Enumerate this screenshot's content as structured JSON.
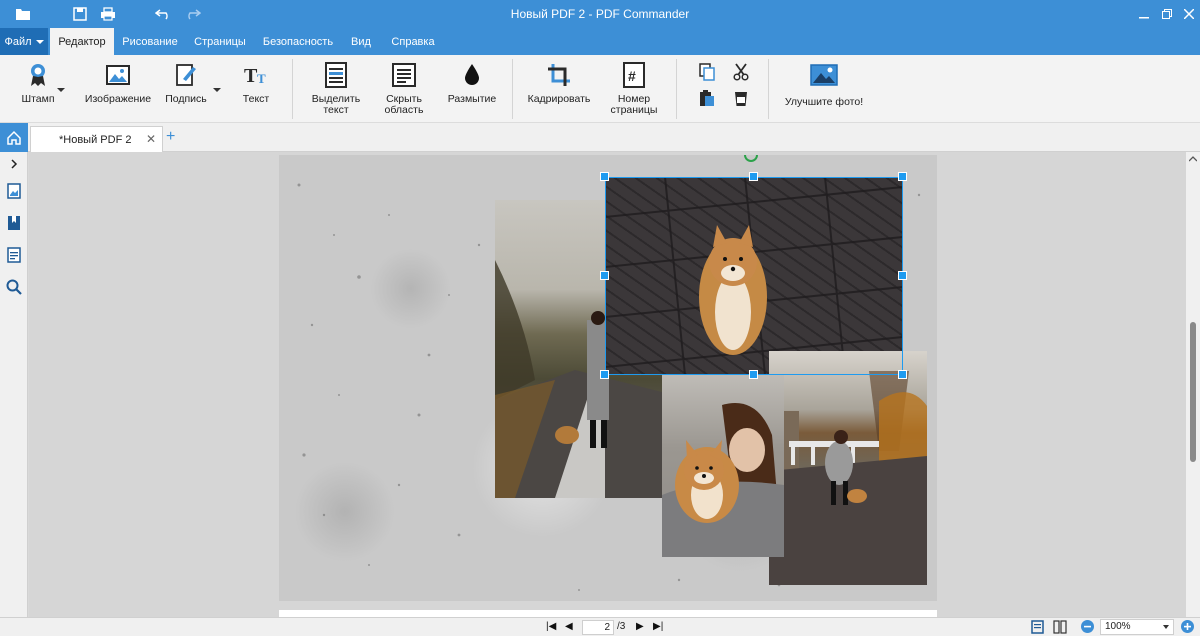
{
  "window": {
    "title": "Новый PDF 2 - PDF Commander"
  },
  "menu": {
    "file_label": "Файл",
    "tabs": [
      {
        "label": "Редактор",
        "active": true
      },
      {
        "label": "Рисование"
      },
      {
        "label": "Страницы"
      },
      {
        "label": "Безопасность"
      },
      {
        "label": "Вид"
      },
      {
        "label": "Справка"
      }
    ]
  },
  "ribbon": {
    "stamp": "Штамп",
    "image": "Изображение",
    "signature": "Подпись",
    "text": "Текст",
    "highlight_text": "Выделить текст",
    "hide_area": "Скрыть область",
    "blur": "Размытие",
    "crop": "Кадрировать",
    "page_number": "Номер страницы",
    "enhance_photo": "Улучшите фото!"
  },
  "document_tab": {
    "name": "*Новый PDF 2"
  },
  "statusbar": {
    "current_page": "2",
    "total_pages": "/3",
    "zoom": "100%"
  },
  "colors": {
    "accent": "#3d8fd6",
    "selection": "#1e9bf0"
  }
}
